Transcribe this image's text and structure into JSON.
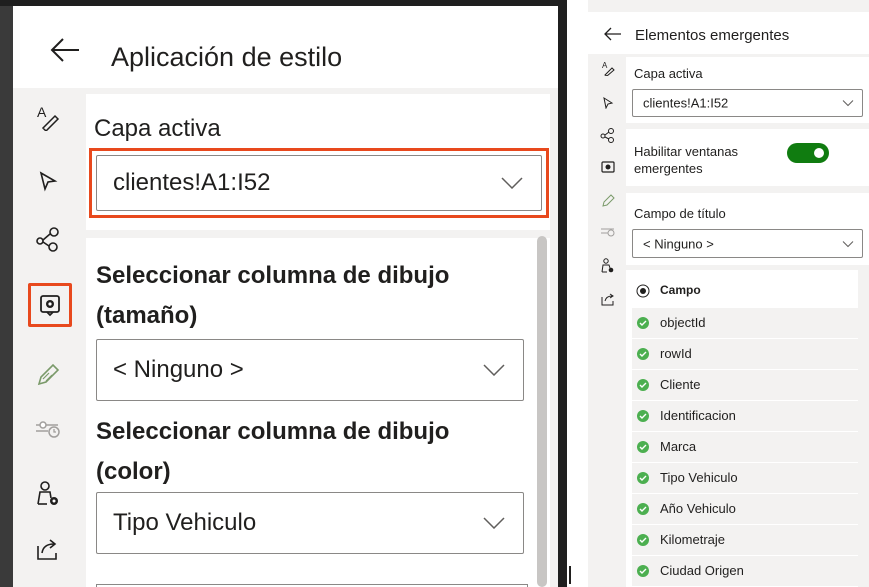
{
  "left_panel": {
    "title": "Aplicación de estilo",
    "capa_label": "Capa activa",
    "capa_value": "clientes!A1:I52",
    "size_label": "Seleccionar columna de dibujo (tamaño)",
    "size_value": "< Ninguno >",
    "color_label": "Seleccionar columna de dibujo (color)",
    "color_value": "Tipo Vehiculo",
    "rail_icons": [
      "style-icon",
      "cursor-icon",
      "nodes-icon",
      "popup-icon",
      "pencil-icon",
      "timeline-icon",
      "people-settings-icon",
      "share-icon"
    ]
  },
  "right_panel": {
    "title": "Elementos emergentes",
    "capa_label": "Capa activa",
    "capa_value": "clientes!A1:I52",
    "enable_label": "Habilitar ventanas emergentes",
    "enable_on": true,
    "title_field_label": "Campo de título",
    "title_field_value": "< Ninguno >",
    "list_header": "Campo",
    "fields": [
      "objectId",
      "rowId",
      "Cliente",
      "Identificacion",
      "Marca",
      "Tipo Vehiculo",
      "Año Vehiculo",
      "Kilometraje",
      "Ciudad Origen"
    ]
  },
  "colors": {
    "accent": "#e8491d",
    "toggle_on": "#107c10",
    "check": "#4caf50"
  }
}
